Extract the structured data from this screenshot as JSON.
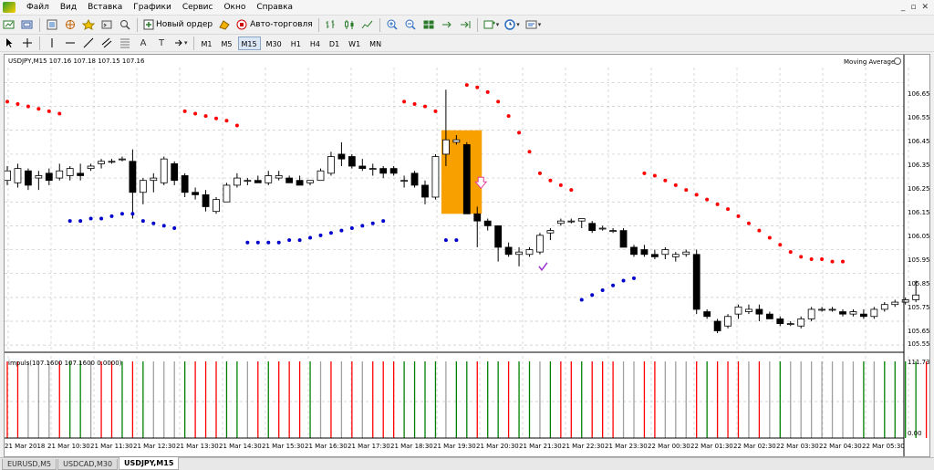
{
  "menu": {
    "items": [
      "Файл",
      "Вид",
      "Вставка",
      "Графики",
      "Сервис",
      "Окно",
      "Справка"
    ],
    "window_controls": [
      "_",
      "▫",
      "✕"
    ]
  },
  "toolbar": {
    "new_order_label": "Новый ордер",
    "auto_trading_label": "Авто-торговля",
    "timeframes": [
      "M1",
      "M5",
      "M15",
      "M30",
      "H1",
      "H4",
      "D1",
      "W1",
      "MN"
    ],
    "active_timeframe": "M15",
    "draw_tools": [
      "A",
      "T"
    ]
  },
  "chart": {
    "header": "USDJPY,M15  107.16 107.18 107.15 107.16",
    "indicator_label": "Moving Average",
    "price_labels": [
      "106.65",
      "106.55",
      "106.45",
      "106.35",
      "106.25",
      "106.15",
      "106.05",
      "105.95",
      "105.85",
      "105.75",
      "105.65",
      "105.55"
    ],
    "sub_header": "impuls(107.1600 107.1600 0.0000)",
    "sub_max": "111.7305",
    "sub_min": "0.00",
    "time_labels": [
      "21 Mar 2018",
      "21 Mar 10:30",
      "21 Mar 11:30",
      "21 Mar 12:30",
      "21 Mar 13:30",
      "21 Mar 14:30",
      "21 Mar 15:30",
      "21 Mar 16:30",
      "21 Mar 17:30",
      "21 Mar 18:30",
      "21 Mar 19:30",
      "21 Mar 20:30",
      "21 Mar 21:30",
      "21 Mar 22:30",
      "21 Mar 23:30",
      "22 Mar 00:30",
      "22 Mar 01:30",
      "22 Mar 02:30",
      "22 Mar 03:30",
      "22 Mar 04:30",
      "22 Mar 05:30"
    ]
  },
  "chart_data": {
    "type": "candlestick",
    "symbol": "USDJPY",
    "timeframe": "M15",
    "ylim": [
      105.52,
      106.69
    ],
    "candles": [
      {
        "o": 106.24,
        "h": 106.3,
        "l": 106.22,
        "c": 106.28
      },
      {
        "o": 106.23,
        "h": 106.31,
        "l": 106.21,
        "c": 106.29
      },
      {
        "o": 106.28,
        "h": 106.29,
        "l": 106.2,
        "c": 106.22
      },
      {
        "o": 106.25,
        "h": 106.28,
        "l": 106.2,
        "c": 106.26
      },
      {
        "o": 106.27,
        "h": 106.29,
        "l": 106.22,
        "c": 106.24
      },
      {
        "o": 106.25,
        "h": 106.31,
        "l": 106.24,
        "c": 106.28
      },
      {
        "o": 106.26,
        "h": 106.3,
        "l": 106.24,
        "c": 106.29
      },
      {
        "o": 106.27,
        "h": 106.31,
        "l": 106.24,
        "c": 106.26
      },
      {
        "o": 106.29,
        "h": 106.31,
        "l": 106.28,
        "c": 106.3
      },
      {
        "o": 106.31,
        "h": 106.33,
        "l": 106.29,
        "c": 106.32
      },
      {
        "o": 106.32,
        "h": 106.33,
        "l": 106.31,
        "c": 106.32
      },
      {
        "o": 106.33,
        "h": 106.34,
        "l": 106.32,
        "c": 106.33
      },
      {
        "o": 106.32,
        "h": 106.37,
        "l": 106.08,
        "c": 106.19
      },
      {
        "o": 106.19,
        "h": 106.25,
        "l": 106.14,
        "c": 106.24
      },
      {
        "o": 106.24,
        "h": 106.27,
        "l": 106.19,
        "c": 106.25
      },
      {
        "o": 106.23,
        "h": 106.34,
        "l": 106.22,
        "c": 106.33
      },
      {
        "o": 106.31,
        "h": 106.32,
        "l": 106.22,
        "c": 106.24
      },
      {
        "o": 106.26,
        "h": 106.27,
        "l": 106.17,
        "c": 106.19
      },
      {
        "o": 106.19,
        "h": 106.21,
        "l": 106.16,
        "c": 106.18
      },
      {
        "o": 106.18,
        "h": 106.2,
        "l": 106.11,
        "c": 106.13
      },
      {
        "o": 106.11,
        "h": 106.17,
        "l": 106.1,
        "c": 106.16
      },
      {
        "o": 106.15,
        "h": 106.23,
        "l": 106.15,
        "c": 106.22
      },
      {
        "o": 106.22,
        "h": 106.27,
        "l": 106.21,
        "c": 106.25
      },
      {
        "o": 106.24,
        "h": 106.25,
        "l": 106.22,
        "c": 106.24
      },
      {
        "o": 106.24,
        "h": 106.26,
        "l": 106.23,
        "c": 106.23
      },
      {
        "o": 106.23,
        "h": 106.28,
        "l": 106.22,
        "c": 106.26
      },
      {
        "o": 106.25,
        "h": 106.28,
        "l": 106.24,
        "c": 106.26
      },
      {
        "o": 106.25,
        "h": 106.26,
        "l": 106.23,
        "c": 106.23
      },
      {
        "o": 106.24,
        "h": 106.26,
        "l": 106.22,
        "c": 106.22
      },
      {
        "o": 106.23,
        "h": 106.24,
        "l": 106.22,
        "c": 106.24
      },
      {
        "o": 106.24,
        "h": 106.29,
        "l": 106.24,
        "c": 106.28
      },
      {
        "o": 106.27,
        "h": 106.36,
        "l": 106.26,
        "c": 106.34
      },
      {
        "o": 106.35,
        "h": 106.4,
        "l": 106.3,
        "c": 106.33
      },
      {
        "o": 106.34,
        "h": 106.35,
        "l": 106.29,
        "c": 106.3
      },
      {
        "o": 106.3,
        "h": 106.33,
        "l": 106.28,
        "c": 106.29
      },
      {
        "o": 106.29,
        "h": 106.31,
        "l": 106.26,
        "c": 106.29
      },
      {
        "o": 106.29,
        "h": 106.3,
        "l": 106.25,
        "c": 106.27
      },
      {
        "o": 106.29,
        "h": 106.3,
        "l": 106.26,
        "c": 106.27
      },
      {
        "o": 106.24,
        "h": 106.26,
        "l": 106.21,
        "c": 106.24
      },
      {
        "o": 106.27,
        "h": 106.28,
        "l": 106.21,
        "c": 106.22
      },
      {
        "o": 106.22,
        "h": 106.24,
        "l": 106.14,
        "c": 106.17
      },
      {
        "o": 106.17,
        "h": 106.35,
        "l": 106.16,
        "c": 106.34
      },
      {
        "o": 106.35,
        "h": 106.62,
        "l": 106.3,
        "c": 106.41
      },
      {
        "o": 106.4,
        "h": 106.43,
        "l": 106.39,
        "c": 106.41
      },
      {
        "o": 106.39,
        "h": 106.4,
        "l": 106.1,
        "c": 106.1
      },
      {
        "o": 106.1,
        "h": 106.13,
        "l": 105.96,
        "c": 106.07
      },
      {
        "o": 106.07,
        "h": 106.08,
        "l": 106.03,
        "c": 106.05
      },
      {
        "o": 106.05,
        "h": 106.05,
        "l": 105.9,
        "c": 105.96
      },
      {
        "o": 105.96,
        "h": 105.98,
        "l": 105.92,
        "c": 105.93
      },
      {
        "o": 105.93,
        "h": 105.96,
        "l": 105.88,
        "c": 105.94
      },
      {
        "o": 105.93,
        "h": 105.96,
        "l": 105.92,
        "c": 105.95
      },
      {
        "o": 105.94,
        "h": 106.02,
        "l": 105.93,
        "c": 106.01
      },
      {
        "o": 106.02,
        "h": 106.04,
        "l": 105.99,
        "c": 106.03
      },
      {
        "o": 106.06,
        "h": 106.08,
        "l": 106.05,
        "c": 106.07
      },
      {
        "o": 106.07,
        "h": 106.08,
        "l": 106.06,
        "c": 106.07
      },
      {
        "o": 106.07,
        "h": 106.08,
        "l": 106.04,
        "c": 106.08
      },
      {
        "o": 106.06,
        "h": 106.07,
        "l": 106.02,
        "c": 106.03
      },
      {
        "o": 106.04,
        "h": 106.05,
        "l": 106.03,
        "c": 106.04
      },
      {
        "o": 106.03,
        "h": 106.04,
        "l": 106.02,
        "c": 106.03
      },
      {
        "o": 106.03,
        "h": 106.04,
        "l": 105.96,
        "c": 105.96
      },
      {
        "o": 105.96,
        "h": 105.97,
        "l": 105.92,
        "c": 105.93
      },
      {
        "o": 105.95,
        "h": 105.97,
        "l": 105.92,
        "c": 105.93
      },
      {
        "o": 105.93,
        "h": 105.95,
        "l": 105.91,
        "c": 105.92
      },
      {
        "o": 105.93,
        "h": 105.96,
        "l": 105.91,
        "c": 105.95
      },
      {
        "o": 105.92,
        "h": 105.94,
        "l": 105.9,
        "c": 105.93
      },
      {
        "o": 105.93,
        "h": 105.95,
        "l": 105.92,
        "c": 105.94
      },
      {
        "o": 105.93,
        "h": 105.95,
        "l": 105.68,
        "c": 105.7
      },
      {
        "o": 105.69,
        "h": 105.7,
        "l": 105.66,
        "c": 105.67
      },
      {
        "o": 105.65,
        "h": 105.66,
        "l": 105.6,
        "c": 105.61
      },
      {
        "o": 105.63,
        "h": 105.68,
        "l": 105.62,
        "c": 105.67
      },
      {
        "o": 105.68,
        "h": 105.72,
        "l": 105.66,
        "c": 105.71
      },
      {
        "o": 105.69,
        "h": 105.72,
        "l": 105.68,
        "c": 105.7
      },
      {
        "o": 105.7,
        "h": 105.72,
        "l": 105.65,
        "c": 105.68
      },
      {
        "o": 105.68,
        "h": 105.69,
        "l": 105.66,
        "c": 105.66
      },
      {
        "o": 105.66,
        "h": 105.67,
        "l": 105.63,
        "c": 105.64
      },
      {
        "o": 105.64,
        "h": 105.65,
        "l": 105.63,
        "c": 105.64
      },
      {
        "o": 105.63,
        "h": 105.67,
        "l": 105.62,
        "c": 105.66
      },
      {
        "o": 105.66,
        "h": 105.71,
        "l": 105.65,
        "c": 105.7
      },
      {
        "o": 105.7,
        "h": 105.71,
        "l": 105.69,
        "c": 105.7
      },
      {
        "o": 105.7,
        "h": 105.71,
        "l": 105.69,
        "c": 105.7
      },
      {
        "o": 105.69,
        "h": 105.7,
        "l": 105.67,
        "c": 105.68
      },
      {
        "o": 105.68,
        "h": 105.7,
        "l": 105.67,
        "c": 105.69
      },
      {
        "o": 105.68,
        "h": 105.7,
        "l": 105.66,
        "c": 105.67
      },
      {
        "o": 105.67,
        "h": 105.71,
        "l": 105.66,
        "c": 105.7
      },
      {
        "o": 105.7,
        "h": 105.73,
        "l": 105.69,
        "c": 105.72
      },
      {
        "o": 105.72,
        "h": 105.74,
        "l": 105.71,
        "c": 105.73
      },
      {
        "o": 105.73,
        "h": 105.75,
        "l": 105.72,
        "c": 105.74
      },
      {
        "o": 105.74,
        "h": 105.82,
        "l": 105.73,
        "c": 105.76
      }
    ],
    "sar_upper": [
      {
        "i": 0,
        "v": 106.57
      },
      {
        "i": 1,
        "v": 106.56
      },
      {
        "i": 2,
        "v": 106.55
      },
      {
        "i": 3,
        "v": 106.54
      },
      {
        "i": 4,
        "v": 106.53
      },
      {
        "i": 5,
        "v": 106.52
      },
      {
        "i": 17,
        "v": 106.53
      },
      {
        "i": 18,
        "v": 106.52
      },
      {
        "i": 19,
        "v": 106.51
      },
      {
        "i": 20,
        "v": 106.5
      },
      {
        "i": 21,
        "v": 106.49
      },
      {
        "i": 22,
        "v": 106.47
      },
      {
        "i": 38,
        "v": 106.57
      },
      {
        "i": 39,
        "v": 106.56
      },
      {
        "i": 40,
        "v": 106.55
      },
      {
        "i": 41,
        "v": 106.53
      },
      {
        "i": 44,
        "v": 106.64
      },
      {
        "i": 45,
        "v": 106.63
      },
      {
        "i": 46,
        "v": 106.61
      },
      {
        "i": 47,
        "v": 106.57
      },
      {
        "i": 48,
        "v": 106.51
      },
      {
        "i": 49,
        "v": 106.44
      },
      {
        "i": 50,
        "v": 106.36
      },
      {
        "i": 51,
        "v": 106.27
      },
      {
        "i": 52,
        "v": 106.24
      },
      {
        "i": 53,
        "v": 106.22
      },
      {
        "i": 54,
        "v": 106.2
      },
      {
        "i": 61,
        "v": 106.27
      },
      {
        "i": 62,
        "v": 106.26
      },
      {
        "i": 63,
        "v": 106.24
      },
      {
        "i": 64,
        "v": 106.22
      },
      {
        "i": 65,
        "v": 106.2
      },
      {
        "i": 66,
        "v": 106.18
      },
      {
        "i": 67,
        "v": 106.16
      },
      {
        "i": 68,
        "v": 106.14
      },
      {
        "i": 69,
        "v": 106.12
      },
      {
        "i": 70,
        "v": 106.09
      },
      {
        "i": 71,
        "v": 106.06
      },
      {
        "i": 72,
        "v": 106.03
      },
      {
        "i": 73,
        "v": 106.0
      },
      {
        "i": 74,
        "v": 105.97
      },
      {
        "i": 75,
        "v": 105.94
      },
      {
        "i": 76,
        "v": 105.92
      },
      {
        "i": 77,
        "v": 105.91
      },
      {
        "i": 78,
        "v": 105.91
      },
      {
        "i": 79,
        "v": 105.9
      },
      {
        "i": 80,
        "v": 105.9
      }
    ],
    "sar_lower": [
      {
        "i": 6,
        "v": 106.07
      },
      {
        "i": 7,
        "v": 106.07
      },
      {
        "i": 8,
        "v": 106.08
      },
      {
        "i": 9,
        "v": 106.08
      },
      {
        "i": 10,
        "v": 106.09
      },
      {
        "i": 11,
        "v": 106.1
      },
      {
        "i": 12,
        "v": 106.1
      },
      {
        "i": 13,
        "v": 106.07
      },
      {
        "i": 14,
        "v": 106.06
      },
      {
        "i": 15,
        "v": 106.05
      },
      {
        "i": 16,
        "v": 106.04
      },
      {
        "i": 23,
        "v": 105.98
      },
      {
        "i": 24,
        "v": 105.98
      },
      {
        "i": 25,
        "v": 105.98
      },
      {
        "i": 26,
        "v": 105.98
      },
      {
        "i": 27,
        "v": 105.99
      },
      {
        "i": 28,
        "v": 105.99
      },
      {
        "i": 29,
        "v": 106.0
      },
      {
        "i": 30,
        "v": 106.01
      },
      {
        "i": 31,
        "v": 106.02
      },
      {
        "i": 32,
        "v": 106.03
      },
      {
        "i": 33,
        "v": 106.04
      },
      {
        "i": 34,
        "v": 106.05
      },
      {
        "i": 35,
        "v": 106.06
      },
      {
        "i": 36,
        "v": 106.07
      },
      {
        "i": 42,
        "v": 105.99
      },
      {
        "i": 43,
        "v": 105.99
      },
      {
        "i": 55,
        "v": 105.74
      },
      {
        "i": 56,
        "v": 105.76
      },
      {
        "i": 57,
        "v": 105.78
      },
      {
        "i": 58,
        "v": 105.8
      },
      {
        "i": 59,
        "v": 105.82
      },
      {
        "i": 60,
        "v": 105.83
      }
    ],
    "highlight_box": {
      "from": 42,
      "to": 45,
      "top": 106.45,
      "bottom": 106.1,
      "color": "#f7a000"
    },
    "sell_arrow": {
      "i": 45,
      "v": 106.23
    },
    "check_mark": {
      "i": 51,
      "v": 105.88
    },
    "impulse_colors": [
      "red",
      "red",
      "gray",
      "gray",
      "gray",
      "red",
      "green",
      "green",
      "gray",
      "red",
      "red",
      "green",
      "red",
      "green",
      "gray",
      "gray",
      "gray",
      "green",
      "red",
      "red",
      "red",
      "green",
      "green",
      "gray",
      "red",
      "green",
      "red",
      "red",
      "red",
      "green",
      "gray",
      "red",
      "gray",
      "red",
      "gray",
      "red",
      "red",
      "red",
      "green",
      "green",
      "green",
      "green",
      "gray",
      "green",
      "green",
      "red",
      "green",
      "green",
      "red",
      "green",
      "green",
      "gray",
      "green",
      "red",
      "red",
      "green",
      "red",
      "red",
      "red",
      "gray",
      "gray",
      "red",
      "red",
      "gray",
      "gray",
      "gray",
      "red",
      "green",
      "red",
      "red",
      "red",
      "gray",
      "red",
      "gray",
      "green",
      "gray",
      "gray",
      "gray",
      "gray",
      "gray",
      "gray",
      "gray",
      "green",
      "gray",
      "green",
      "green",
      "green",
      "green",
      "red"
    ],
    "colors": {
      "up_body": "#ffffff",
      "down_body": "#000000",
      "sar_upper": "#ff0000",
      "sar_lower": "#0000cc",
      "impulse_red": "#ff0000",
      "impulse_green": "#008000",
      "impulse_gray": "#a0a0a0",
      "grid": "#c8c8c8"
    }
  }
}
